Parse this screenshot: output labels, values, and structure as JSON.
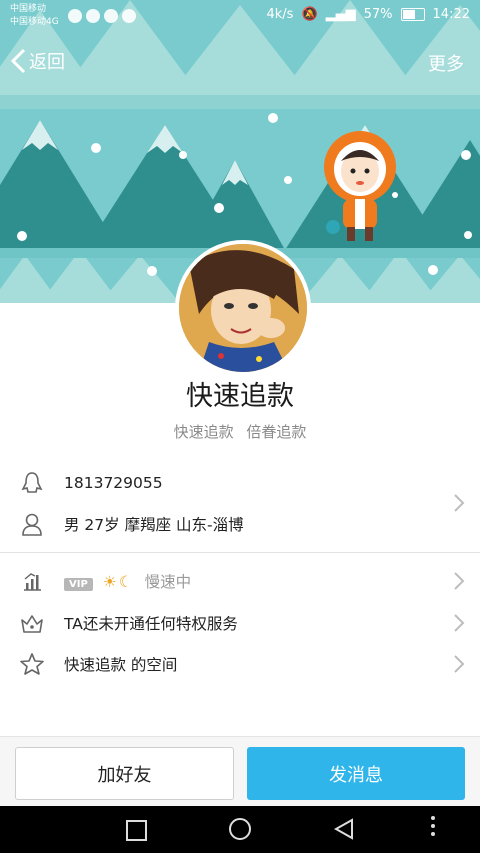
{
  "status_bar": {
    "carrier_1": "中国移动",
    "carrier_2": "中国移动4G",
    "speed": "4k/s",
    "battery": "57%",
    "time": "14:22"
  },
  "nav": {
    "back_label": "返回",
    "more_label": "更多"
  },
  "profile": {
    "nickname": "快速追款",
    "tags": "快速追款  倍眷追款"
  },
  "info": {
    "qq_number": "1813729055",
    "details": "男  27岁  摩羯座  山东-淄博",
    "vip_label": "VIP",
    "vip_status": "慢速中",
    "service_text": "TA还未开通任何特权服务",
    "space_text": "快速追款  的空间"
  },
  "actions": {
    "add_friend": "加好友",
    "send_message": "发消息"
  },
  "colors": {
    "banner_bg": "#6ec6c9",
    "tree_dark": "#2e8f8e",
    "tree_light": "#9fdad8",
    "accent": "#2fb5ea"
  }
}
